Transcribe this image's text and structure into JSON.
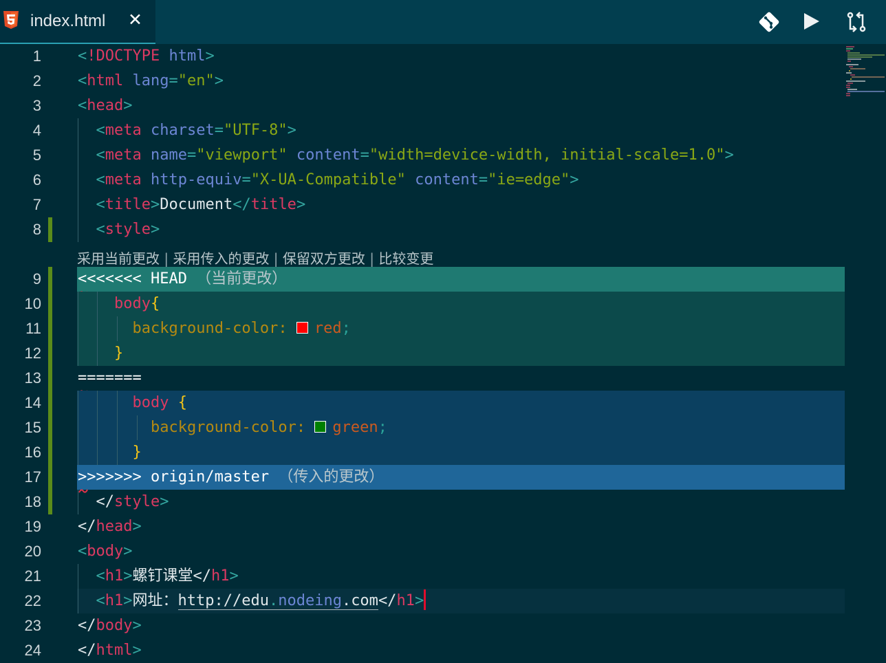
{
  "tab": {
    "label": "index.html",
    "close": "✕"
  },
  "toolbar": {
    "git": "git-icon",
    "run": "play-icon",
    "compare": "compare-icon"
  },
  "codelens": {
    "accept_current": "采用当前更改",
    "accept_incoming": "采用传入的更改",
    "accept_both": "保留双方更改",
    "compare": "比较变更",
    "separator": " | "
  },
  "colors": {
    "current_header": "#1f7a72",
    "current_body": "#0c4a4b",
    "incoming_body": "#0b4060",
    "incoming_header": "#1f6699"
  },
  "lines": {
    "n1": "1",
    "n2": "2",
    "n3": "3",
    "n4": "4",
    "n5": "5",
    "n6": "6",
    "n7": "7",
    "n8": "8",
    "n9": "9",
    "n10": "10",
    "n11": "11",
    "n12": "12",
    "n13": "13",
    "n14": "14",
    "n15": "15",
    "n16": "16",
    "n17": "17",
    "n18": "18",
    "n19": "19",
    "n20": "20",
    "n21": "21",
    "n22": "22",
    "n23": "23",
    "n24": "24"
  },
  "code": {
    "doctype": "!DOCTYPE",
    "html": "html",
    "lang": "lang",
    "en": "\"en\"",
    "head": "head",
    "meta": "meta",
    "charset": "charset",
    "utf8": "\"UTF-8\"",
    "name": "name",
    "viewport": "\"viewport\"",
    "content": "content",
    "viewport_val": "\"width=device-width, initial-scale=1.0\"",
    "http_equiv": "http-equiv",
    "xua": "\"X-UA-Compatible\"",
    "ie_edge": "\"ie=edge\"",
    "title": "title",
    "document": "Document",
    "style": "style",
    "head_marker": "<<<<<<< HEAD",
    "head_note": "（当前更改）",
    "body_sel": "body",
    "bg_prop": "background-color:",
    "red": "red",
    "green": "green",
    "divider": "=======",
    "incoming_marker": ">>>>>>> origin/master",
    "incoming_note": "（传入的更改）",
    "body": "body",
    "h1": "h1",
    "h1_text": "螺钉课堂",
    "url_label": "网址：",
    "url_a": "http://edu",
    "url_dot1": ".",
    "url_b": "nodeing",
    "url_dot2": ".",
    "url_c": "com"
  }
}
